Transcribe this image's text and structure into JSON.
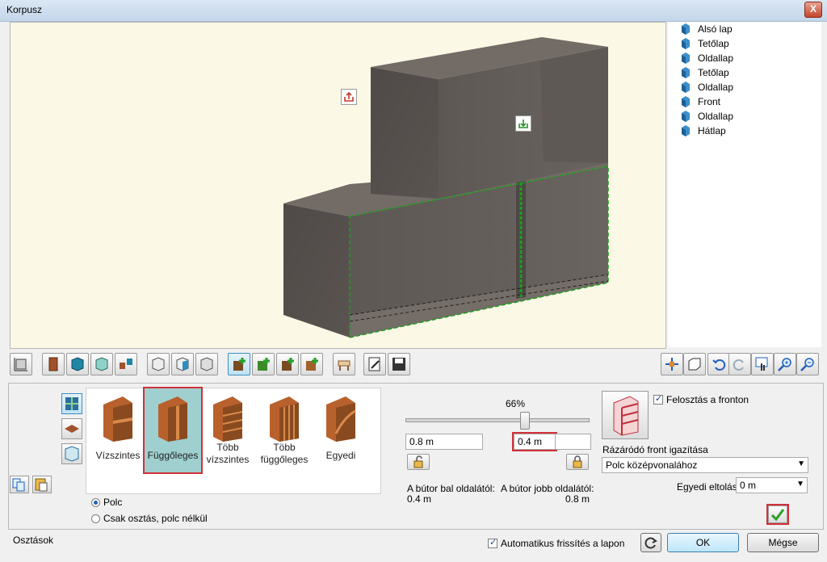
{
  "window": {
    "title": "Korpusz",
    "close_label": "X"
  },
  "tree": {
    "items": [
      {
        "label": "Alsó lap"
      },
      {
        "label": "Tetőlap"
      },
      {
        "label": "Oldallap"
      },
      {
        "label": "Tetőlap"
      },
      {
        "label": "Oldallap"
      },
      {
        "label": "Front"
      },
      {
        "label": "Oldallap"
      },
      {
        "label": "Hátlap"
      }
    ]
  },
  "division_types": [
    {
      "label": "Vízszintes"
    },
    {
      "label": "Függőleges"
    },
    {
      "label": "Több vízszintes"
    },
    {
      "label": "Több függőleges"
    },
    {
      "label": "Egyedi"
    }
  ],
  "shelf_options": {
    "polc_label": "Polc",
    "no_shelf_label": "Csak osztás, polc nélkül"
  },
  "slider": {
    "percent_label": "66%",
    "value": 0.66
  },
  "offsets": {
    "left_value": "0.8 m",
    "right_value": "0.4 m",
    "left_caption": "A bútor bal oldalától:",
    "left_caption_value": "0.4 m",
    "right_caption": "A bútor jobb oldalától:",
    "right_caption_value": "0.8 m"
  },
  "front": {
    "split_label": "Felosztás a fronton",
    "align_label": "Rázáródó front igazítása",
    "align_value": "Polc középvonalához",
    "custom_offset_label": "Egyedi eltolás",
    "custom_offset_value": "0 m"
  },
  "footer": {
    "section_label": "Osztások",
    "auto_refresh_label": "Automatikus frissítés a lapon",
    "ok_label": "OK",
    "cancel_label": "Mégse"
  },
  "colors": {
    "accent": "#3c8fc6",
    "highlight": "#d0313a",
    "wood": "#5d5753"
  }
}
